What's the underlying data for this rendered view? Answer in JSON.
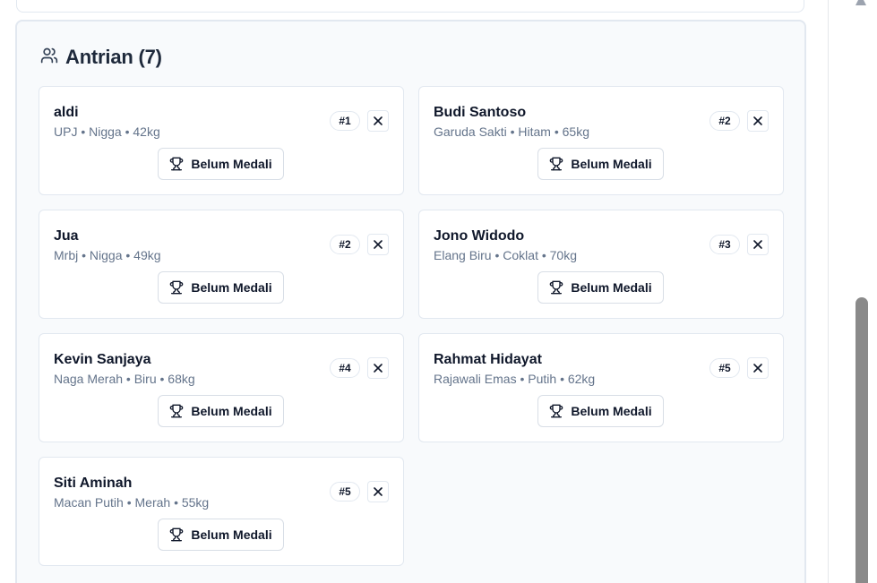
{
  "queue": {
    "title": "Antrian (7)",
    "icon": "users-icon",
    "items": [
      {
        "name": "aldi",
        "meta": "UPJ • Nigga • 42kg",
        "badge": "#1",
        "medal_label": "Belum Medali"
      },
      {
        "name": "Budi Santoso",
        "meta": "Garuda Sakti • Hitam • 65kg",
        "badge": "#2",
        "medal_label": "Belum Medali"
      },
      {
        "name": "Jua",
        "meta": "Mrbj • Nigga • 49kg",
        "badge": "#2",
        "medal_label": "Belum Medali"
      },
      {
        "name": "Jono Widodo",
        "meta": "Elang Biru • Coklat • 70kg",
        "badge": "#3",
        "medal_label": "Belum Medali"
      },
      {
        "name": "Kevin Sanjaya",
        "meta": "Naga Merah • Biru • 68kg",
        "badge": "#4",
        "medal_label": "Belum Medali"
      },
      {
        "name": "Rahmat Hidayat",
        "meta": "Rajawali Emas • Putih • 62kg",
        "badge": "#5",
        "medal_label": "Belum Medali"
      },
      {
        "name": "Siti Aminah",
        "meta": "Macan Putih • Merah • 55kg",
        "badge": "#5",
        "medal_label": "Belum Medali"
      }
    ]
  },
  "colors": {
    "panel_bg": "#f8fafc",
    "border": "#e2e8f0",
    "text": "#0f172a",
    "muted": "#64748b"
  }
}
